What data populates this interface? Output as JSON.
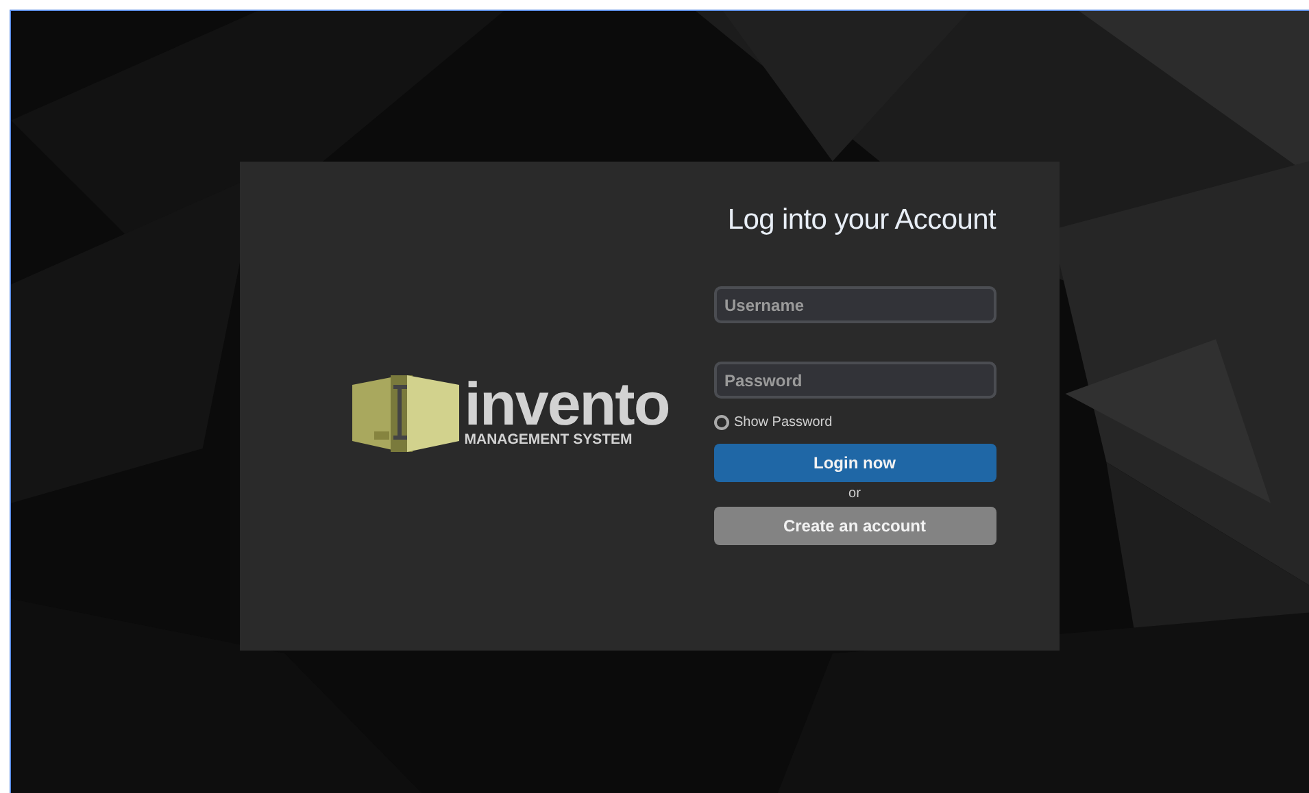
{
  "logo": {
    "name": "invento",
    "tagline": "MANAGEMENT SYSTEM"
  },
  "login": {
    "title": "Log into your Account",
    "fields": [
      {
        "placeholder": "Username"
      },
      {
        "placeholder": "Password"
      }
    ],
    "show_password": {
      "label": "Show Password",
      "checked": false
    },
    "login_button": "Login now",
    "separator": "or",
    "create_button": "Create an account"
  }
}
